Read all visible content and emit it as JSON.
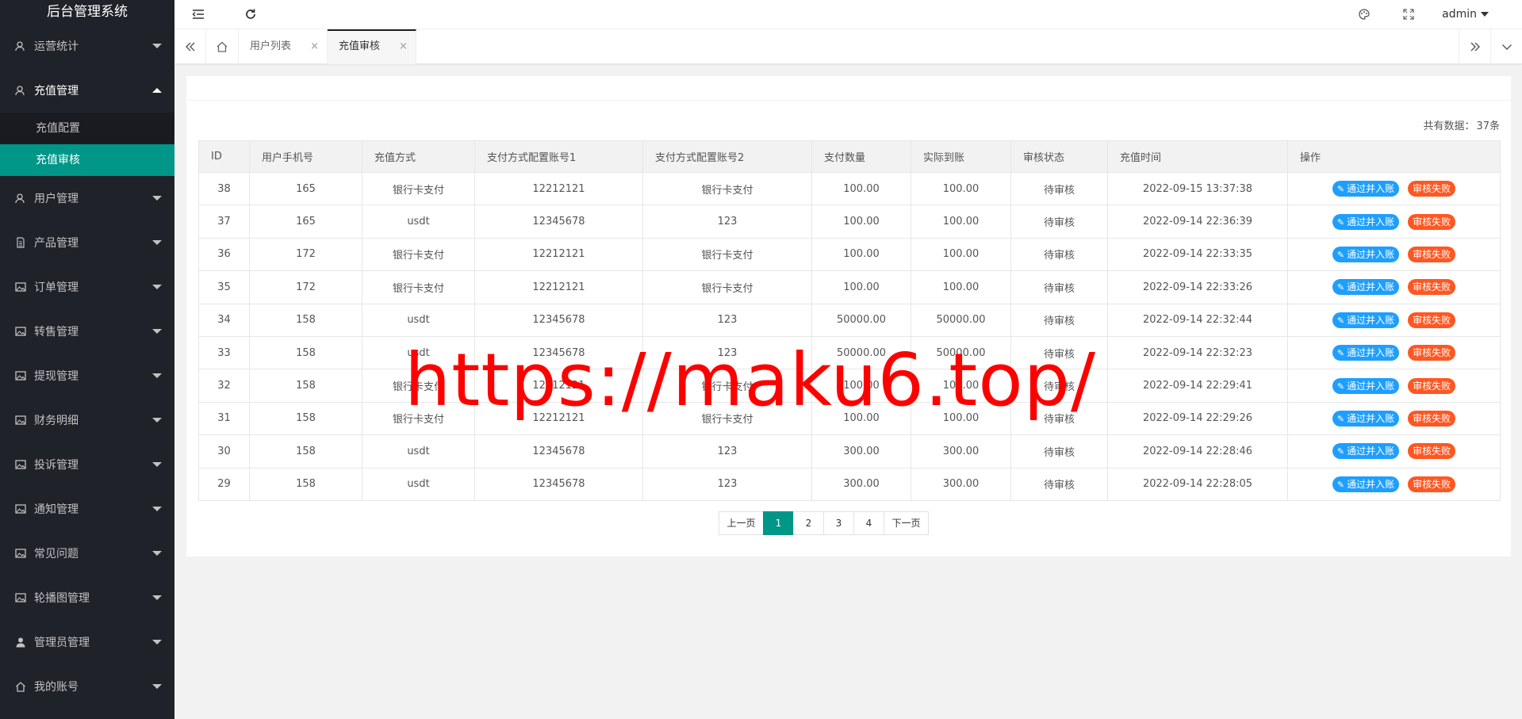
{
  "app_title": "后台管理系统",
  "sidebar": {
    "items": [
      {
        "label": "运营统计",
        "icon": "user-icon",
        "open": false
      },
      {
        "label": "充值管理",
        "icon": "user-icon",
        "open": true,
        "children": [
          {
            "label": "充值配置",
            "active": false
          },
          {
            "label": "充值审核",
            "active": true
          }
        ]
      },
      {
        "label": "用户管理",
        "icon": "user-icon",
        "open": false
      },
      {
        "label": "产品管理",
        "icon": "document-icon",
        "open": false
      },
      {
        "label": "订单管理",
        "icon": "picture-icon",
        "open": false
      },
      {
        "label": "转售管理",
        "icon": "picture-icon",
        "open": false
      },
      {
        "label": "提现管理",
        "icon": "picture-icon",
        "open": false
      },
      {
        "label": "财务明细",
        "icon": "picture-icon",
        "open": false
      },
      {
        "label": "投诉管理",
        "icon": "picture-icon",
        "open": false
      },
      {
        "label": "通知管理",
        "icon": "picture-icon",
        "open": false
      },
      {
        "label": "常见问题",
        "icon": "picture-icon",
        "open": false
      },
      {
        "label": "轮播图管理",
        "icon": "picture-icon",
        "open": false
      },
      {
        "label": "管理员管理",
        "icon": "person-icon",
        "open": false
      },
      {
        "label": "我的账号",
        "icon": "home-icon",
        "open": false
      }
    ]
  },
  "header": {
    "user": "admin",
    "icons": [
      "menu-collapse-icon",
      "refresh-icon",
      "theme-palette-icon",
      "fullscreen-icon"
    ]
  },
  "tabs": {
    "items": [
      {
        "label": "用户列表",
        "active": false
      },
      {
        "label": "充值审核",
        "active": true
      }
    ],
    "close_glyph": "×"
  },
  "summary": {
    "label": "共有数据：",
    "count": "37条"
  },
  "table": {
    "columns": [
      "ID",
      "用户手机号",
      "充值方式",
      "支付方式配置账号1",
      "支付方式配置账号2",
      "支付数量",
      "实际到账",
      "审核状态",
      "充值时间",
      "操作"
    ],
    "rows": [
      [
        "38",
        "165",
        "银行卡支付",
        "12212121",
        "银行卡支付",
        "100.00",
        "100.00",
        "待审核",
        "2022-09-15 13:37:38"
      ],
      [
        "37",
        "165",
        "usdt",
        "12345678",
        "123",
        "100.00",
        "100.00",
        "待审核",
        "2022-09-14 22:36:39"
      ],
      [
        "36",
        "172",
        "银行卡支付",
        "12212121",
        "银行卡支付",
        "100.00",
        "100.00",
        "待审核",
        "2022-09-14 22:33:35"
      ],
      [
        "35",
        "172",
        "银行卡支付",
        "12212121",
        "银行卡支付",
        "100.00",
        "100.00",
        "待审核",
        "2022-09-14 22:33:26"
      ],
      [
        "34",
        "158",
        "usdt",
        "12345678",
        "123",
        "50000.00",
        "50000.00",
        "待审核",
        "2022-09-14 22:32:44"
      ],
      [
        "33",
        "158",
        "usdt",
        "12345678",
        "123",
        "50000.00",
        "50000.00",
        "待审核",
        "2022-09-14 22:32:23"
      ],
      [
        "32",
        "158",
        "银行卡支付",
        "12212121",
        "银行卡支付",
        "100.00",
        "100.00",
        "待审核",
        "2022-09-14 22:29:41"
      ],
      [
        "31",
        "158",
        "银行卡支付",
        "12212121",
        "银行卡支付",
        "100.00",
        "100.00",
        "待审核",
        "2022-09-14 22:29:26"
      ],
      [
        "30",
        "158",
        "usdt",
        "12345678",
        "123",
        "300.00",
        "300.00",
        "待审核",
        "2022-09-14 22:28:46"
      ],
      [
        "29",
        "158",
        "usdt",
        "12345678",
        "123",
        "300.00",
        "300.00",
        "待审核",
        "2022-09-14 22:28:05"
      ]
    ],
    "action_pass": "通过并入账",
    "action_fail": "审核失败"
  },
  "pagination": {
    "prev": "上一页",
    "pages": [
      "1",
      "2",
      "3",
      "4"
    ],
    "current": "1",
    "next": "下一页"
  },
  "watermark": "https://maku6.top/",
  "colors": {
    "sidebar_bg": "#20222a",
    "accent": "#009688",
    "pass_button": "#1e9fff",
    "fail_button": "#ff5722",
    "watermark": "#ff0000"
  }
}
